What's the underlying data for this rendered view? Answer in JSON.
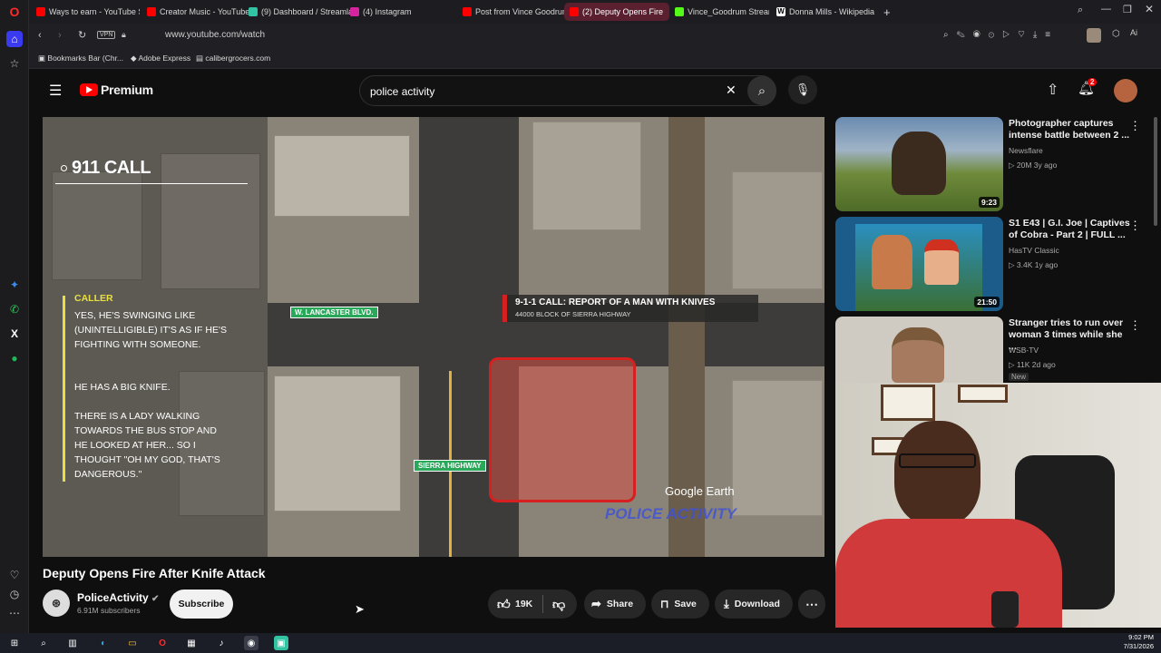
{
  "browser": {
    "tabs": [
      {
        "label": "Ways to earn - YouTube S",
        "icon": "youtube-icon"
      },
      {
        "label": "Creator Music - YouTube S",
        "icon": "youtube-icon"
      },
      {
        "label": "(9) Dashboard / Streamlab",
        "icon": "streamlabs-icon"
      },
      {
        "label": "(4) Instagram",
        "icon": "instagram-icon"
      },
      {
        "label": "Post from Vince Goodrum",
        "icon": "youtube-icon"
      },
      {
        "label": "(2) Deputy Opens Fire",
        "icon": "youtube-icon",
        "active": true
      },
      {
        "label": "Vince_Goodrum Stream -",
        "icon": "kick-icon"
      },
      {
        "label": "Donna Mills - Wikipedia",
        "icon": "wikipedia-icon"
      }
    ],
    "vpn_label": "VPN",
    "url": "www.youtube.com/watch",
    "bookmarks": [
      {
        "label": "Bookmarks Bar (Chr..."
      },
      {
        "label": "Adobe Express"
      },
      {
        "label": "calibergrocers.com"
      }
    ],
    "ai_label": "Ai"
  },
  "youtube": {
    "logo_text": "Premium",
    "search_query": "police activity",
    "notification_count": "2"
  },
  "video_overlay": {
    "call_title": "911 CALL",
    "caller_label": "CALLER",
    "transcript": [
      "YES, HE'S SWINGING LIKE (UNINTELLIGIBLE) IT'S AS IF HE'S FIGHTING WITH SOMEONE.",
      "HE HAS A BIG KNIFE.",
      "THERE IS A LADY WALKING TOWARDS THE BUS STOP AND HE LOOKED AT HER... SO I THOUGHT \"OH MY GOD, THAT'S DANGEROUS.\""
    ],
    "street_labels": [
      "W. LANCASTER BLVD.",
      "SIERRA HIGHWAY"
    ],
    "report_title": "9-1-1 CALL: REPORT OF A MAN WITH KNIVES",
    "report_location": "44000 BLOCK OF SIERRA HIGHWAY",
    "map_credit": "Google Earth",
    "watermark": "POLICE ACTIVITY"
  },
  "video": {
    "title": "Deputy Opens Fire After Knife Attack",
    "channel": "PoliceActivity",
    "subscribers": "6.91M subscribers",
    "subscribe_label": "Subscribe",
    "likes": "19K",
    "share_label": "Share",
    "save_label": "Save",
    "download_label": "Download"
  },
  "recommendations": [
    {
      "title": "Photographer captures intense battle between 2 ...",
      "channel": "Newsflare",
      "meta": "20M  3y ago",
      "duration": "9:23"
    },
    {
      "title": "S1 E43 | G.I. Joe | Captives of Cobra - Part 2 | FULL ...",
      "channel": "HasTV Classic",
      "meta": "3.4K  1y ago",
      "duration": "21:50"
    },
    {
      "title": "Stranger tries to run over woman 3 times while she ...",
      "channel": "WSB-TV",
      "meta": "11K  2d ago",
      "badge": "New"
    }
  ],
  "taskbar": {
    "time": "9:02 PM",
    "date": "7/31/2026"
  },
  "colors": {
    "youtube_red": "#ff0000",
    "active_tab": "#5a2030",
    "overlay_yellow": "#e8e042",
    "report_red": "#d62020"
  }
}
